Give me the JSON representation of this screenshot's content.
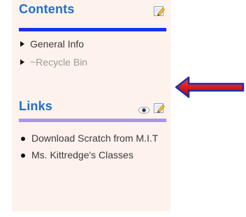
{
  "contents": {
    "title": "Contents",
    "edit_icon": "edit-pencil-icon",
    "items": [
      {
        "label": "General Info",
        "style": "normal"
      },
      {
        "label": "~Recycle Bin",
        "style": "muted"
      }
    ]
  },
  "links": {
    "title": "Links",
    "view_icon": "eye-icon",
    "edit_icon": "edit-pencil-icon",
    "items": [
      {
        "label": "Download Scratch from M.I.T"
      },
      {
        "label": "Ms. Kittredge's Classes"
      }
    ]
  },
  "annotation": {
    "arrow_icon": "red-arrow-icon",
    "arrow_fill": "#d42020",
    "arrow_outline": "#1f2db3"
  },
  "colors": {
    "panel_bg": "#fdf2ec",
    "heading": "#1d6fcf",
    "contents_rule": "#1434e6",
    "links_rule": "#a796ea"
  }
}
